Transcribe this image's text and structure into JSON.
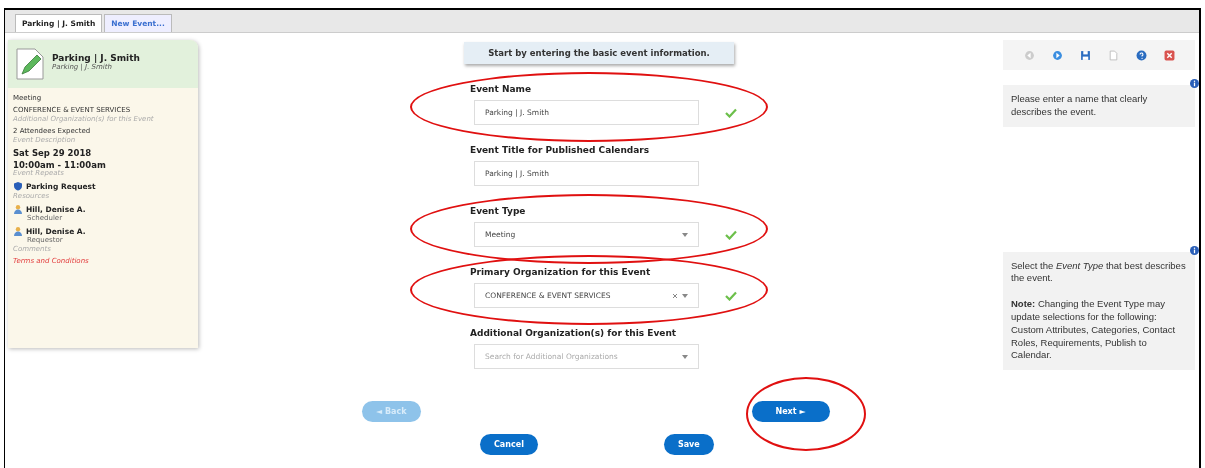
{
  "tabs": [
    {
      "label": "Parking | J. Smith",
      "selected": true
    },
    {
      "label": "New Event...",
      "selected": false
    }
  ],
  "summary": {
    "title": "Parking | J. Smith",
    "subtitle": "Parking | J. Smith",
    "items": [
      {
        "kind": "text",
        "text": "Meeting"
      },
      {
        "kind": "text",
        "text": "CONFERENCE & EVENT SERVICES"
      },
      {
        "kind": "hint",
        "text": "Additional Organization(s) for this Event"
      },
      {
        "kind": "text",
        "text": "2 Attendees Expected"
      },
      {
        "kind": "hint",
        "text": "Event Description"
      },
      {
        "kind": "date",
        "text": "Sat Sep 29 2018"
      },
      {
        "kind": "date",
        "text": "10:00am - 11:00am"
      },
      {
        "kind": "hint",
        "text": "Event Repeats"
      },
      {
        "kind": "requirement",
        "text": "Parking Request"
      },
      {
        "kind": "hint",
        "text": "Resources"
      },
      {
        "kind": "person",
        "text": "Hill, Denise A.",
        "role": "Scheduler"
      },
      {
        "kind": "person",
        "text": "Hill, Denise A.",
        "role": "Requestor"
      },
      {
        "kind": "hint",
        "text": "Comments"
      },
      {
        "kind": "link",
        "text": "Terms and Conditions"
      }
    ]
  },
  "banner": "Start by entering the basic event information.",
  "fields": [
    {
      "label": "Event Name",
      "kind": "text",
      "value": "Parking | J. Smith",
      "valid": true,
      "highlighted": true
    },
    {
      "label": "Event Title for Published Calendars",
      "kind": "text",
      "value": "Parking | J. Smith",
      "valid": false,
      "highlighted": false
    },
    {
      "label": "Event Type",
      "kind": "select",
      "value": "Meeting",
      "valid": true,
      "highlighted": true
    },
    {
      "label": "Primary Organization for this Event",
      "kind": "clearable-select",
      "value": "CONFERENCE & EVENT SERVICES",
      "valid": true,
      "highlighted": true
    },
    {
      "label": "Additional Organization(s) for this Event",
      "kind": "search-select",
      "placeholder": "Search for Additional Organizations",
      "valid": false,
      "highlighted": false
    }
  ],
  "nav_buttons": [
    {
      "label": "◄ Back",
      "disabled": true
    },
    {
      "label": "Next ►",
      "disabled": false,
      "highlighted": true
    }
  ],
  "action_buttons": [
    {
      "label": "Cancel"
    },
    {
      "label": "Save"
    }
  ],
  "help": [
    "Please enter a name that clearly describes the event.",
    "Select the *Event Type* that best describes the event.\n\n**Note:** Changing the Event Type may update selections for the following: Custom Attributes, Categories, Contact Roles, Requirements, Publish to Calendar."
  ]
}
